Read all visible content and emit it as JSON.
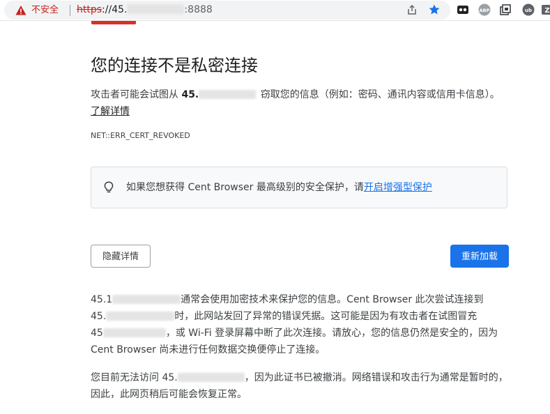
{
  "browser": {
    "security_label": "不安全",
    "url_scheme": "https",
    "url_rest_prefix": "://45.",
    "url_port": ":8888",
    "icons": [
      "warning-triangle-icon",
      "share-icon",
      "star-icon",
      "extension-icons"
    ]
  },
  "page": {
    "heading": "您的连接不是私密连接",
    "intro_prefix": "攻击者可能会试图从 ",
    "intro_host": "45.",
    "intro_suffix": " 窃取您的信息（例如：密码、通讯内容或信用卡信息）。",
    "learn_more": "了解详情",
    "error_code": "NET::ERR_CERT_REVOKED",
    "tip_text": "如果您想获得 Cent Browser 最高级别的安全保护，请",
    "tip_link": "开启增强型保护",
    "hide_details_button": "隐藏详情",
    "reload_button": "重新加载",
    "details_p1_a": "45.1",
    "details_p1_b": "通常会使用加密技术来保护您的信息。Cent Browser 此次尝试连接到",
    "details_p1_c": "45.",
    "details_p1_d": "时，此网站发回了异常的错误凭据。这可能是因为有攻击者在试图冒充",
    "details_p1_e": "45",
    "details_p1_f": "，或 Wi-Fi 登录屏幕中断了此次连接。请放心，您的信息仍然是安全的，因为 Cent Browser 尚未进行任何数据交换便停止了连接。",
    "details_p2_a": "您目前无法访问 45.",
    "details_p2_b": "，因为此证书已被撤消。网络错误和攻击行为通常是暂时的，因此，此网页稍后可能会恢复正常。"
  },
  "colors": {
    "danger": "#d93025",
    "accent": "#1a73e8"
  }
}
